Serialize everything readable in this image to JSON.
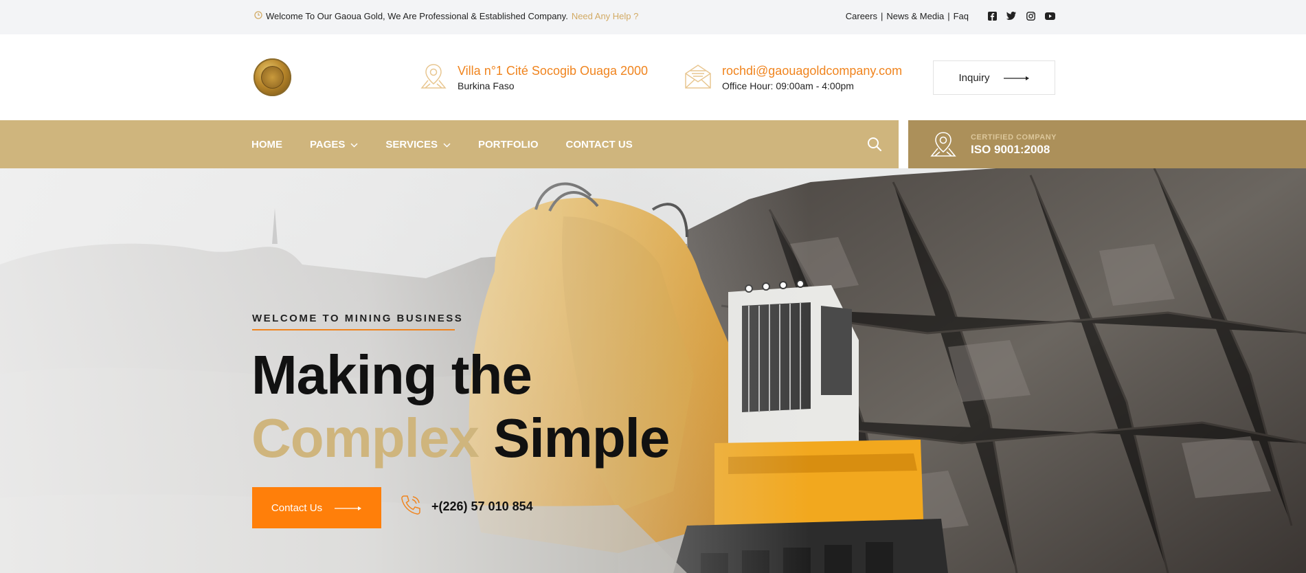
{
  "topbar": {
    "welcome": "Welcome To Our Gaoua Gold, We Are Professional & Established Company.",
    "help": "Need Any Help ?",
    "links": [
      "Careers",
      "News & Media",
      "Faq"
    ],
    "social_icons": [
      "facebook-icon",
      "twitter-icon",
      "instagram-icon",
      "youtube-icon"
    ]
  },
  "header": {
    "address_title": "Villa n°1 Cité Socogib Ouaga 2000",
    "address_sub": "Burkina Faso",
    "email": "rochdi@gaouagoldcompany.com",
    "office_hours": "Office Hour: 09:00am - 4:00pm",
    "inquiry_label": "Inquiry"
  },
  "nav": {
    "items": [
      {
        "label": "HOME",
        "has_dropdown": false
      },
      {
        "label": "PAGES",
        "has_dropdown": true
      },
      {
        "label": "SERVICES",
        "has_dropdown": true
      },
      {
        "label": "PORTFOLIO",
        "has_dropdown": false
      },
      {
        "label": "CONTACT US",
        "has_dropdown": false
      }
    ]
  },
  "certified": {
    "small": "CERTIFIED COMPANY",
    "big": "ISO 9001:2008"
  },
  "hero": {
    "tag": "WELCOME TO MINING BUSINESS",
    "line1": "Making the",
    "line2_gold": "Complex",
    "line2_rest": "Simple",
    "cta_label": "Contact Us",
    "phone": "+(226) 57 010 854"
  },
  "colors": {
    "accent_orange": "#f0841e",
    "gold": "#cfb57d",
    "gold_dark": "#ac905a",
    "button_orange": "#ff7f0a"
  }
}
